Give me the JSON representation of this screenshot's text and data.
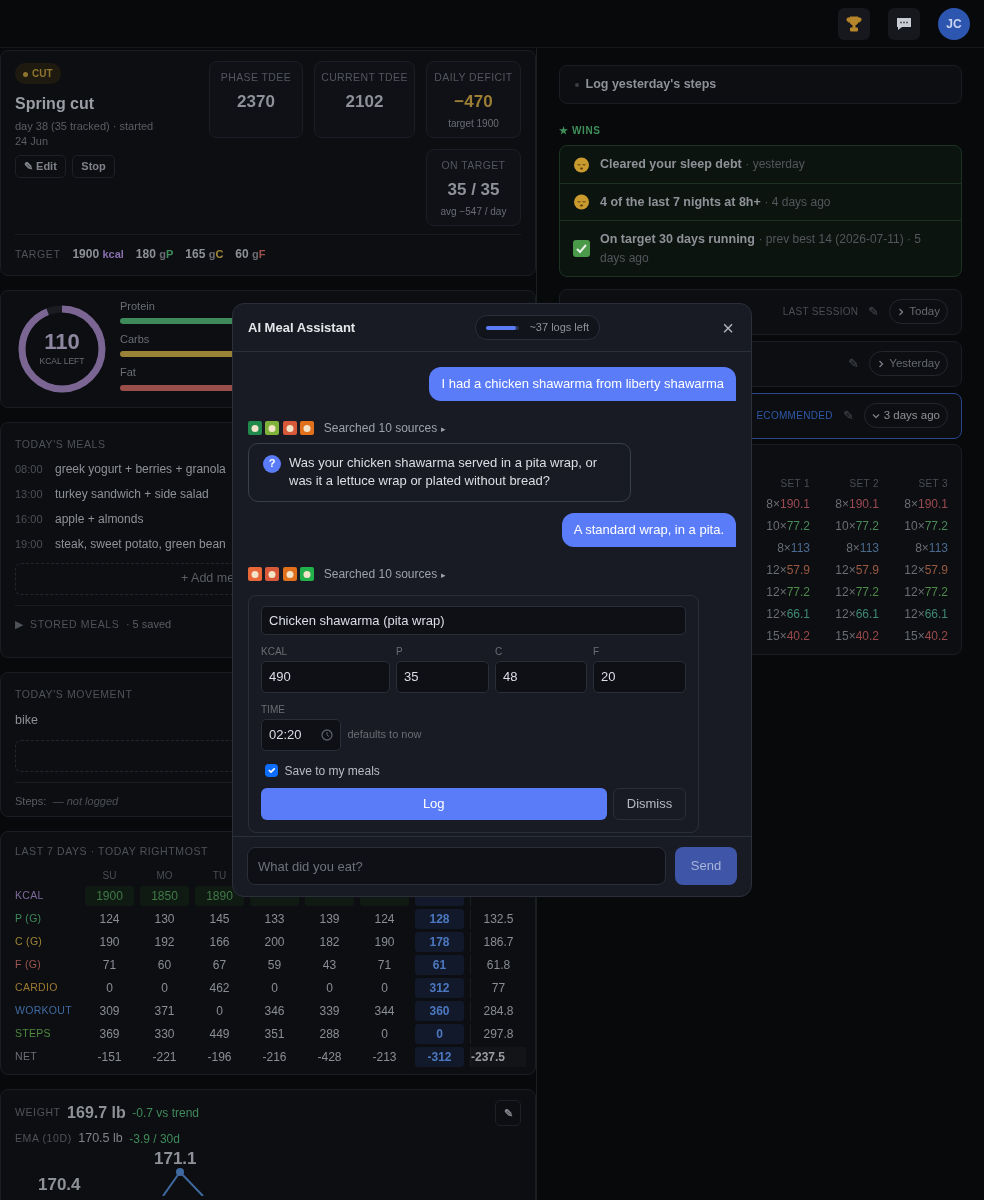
{
  "top_bar": {
    "avatar": "JC"
  },
  "phase": {
    "badge": "CUT",
    "title": "Spring cut",
    "subtitle": "day 38 (35 tracked) · started 24 Jun",
    "buttons": [
      "✎ Edit",
      "Stop"
    ],
    "stats": [
      {
        "label": "PHASE TDEE",
        "value": "2370",
        "kind": "plain"
      },
      {
        "label": "CURRENT TDEE",
        "value": "2102",
        "kind": "plain"
      },
      {
        "label": "DAILY DEFICIT",
        "value": "−470",
        "note": "target 1900",
        "kind": "accent"
      },
      {
        "label": "ON TARGET",
        "value": "35 / 35",
        "note": "avg −547 / day",
        "kind": "plain"
      }
    ],
    "target_label": "TARGET",
    "targets": [
      {
        "value": "1900",
        "macro": "kcal",
        "color": "#8a6fae"
      },
      {
        "value": "180",
        "unit": "g",
        "macro": "P",
        "color": "#3f8f5a"
      },
      {
        "value": "165",
        "unit": "g",
        "macro": "C",
        "color": "#a38a35"
      },
      {
        "value": "60",
        "unit": "g",
        "macro": "F",
        "color": "#a0504a"
      }
    ]
  },
  "macros": {
    "ring": {
      "value": "110",
      "label": "KCAL LEFT",
      "level": 0.94
    },
    "bars": [
      {
        "label": "Protein",
        "color": "#3f8a5a"
      },
      {
        "label": "Carbs",
        "color": "#9a8236"
      },
      {
        "label": "Fat",
        "color": "#9a4e4a"
      }
    ]
  },
  "meals": {
    "title": "TODAY'S MEALS",
    "items": [
      {
        "time": "08:00",
        "name": "greek yogurt + berries + granola"
      },
      {
        "time": "13:00",
        "name": "turkey sandwich + side salad"
      },
      {
        "time": "16:00",
        "name": "apple + almonds"
      },
      {
        "time": "19:00",
        "name": "steak, sweet potato, green bean"
      }
    ],
    "add_button": "+ Add me",
    "stored_arrow": "▶",
    "stored_label": "STORED MEALS",
    "stored_count": "· 5 saved"
  },
  "movement": {
    "title": "TODAY'S MOVEMENT",
    "activity": "bike",
    "steps_label": "Steps:",
    "steps_value": "— not logged"
  },
  "last7": {
    "title": "LAST 7 DAYS · TODAY RIGHTMOST",
    "days": [
      "SU",
      "MO",
      "TU"
    ],
    "rows": [
      {
        "label": "KCAL",
        "kind": "kcal",
        "color": "#7e6a9b",
        "values": [
          "1900",
          "1850",
          "1890"
        ]
      },
      {
        "label": "P (G)",
        "kind": "plain",
        "color": "#3f8a5a",
        "values": [
          "124",
          "130",
          "145",
          "133",
          "139",
          "124"
        ],
        "today": "128",
        "average": "132.5"
      },
      {
        "label": "C (G)",
        "kind": "plain",
        "color": "#a08636",
        "values": [
          "190",
          "192",
          "166",
          "200",
          "182",
          "190"
        ],
        "today": "178",
        "average": "186.7"
      },
      {
        "label": "F (G)",
        "kind": "plain",
        "color": "#a0564f",
        "values": [
          "71",
          "60",
          "67",
          "59",
          "43",
          "71"
        ],
        "today": "61",
        "average": "61.8"
      },
      {
        "label": "CARDIO",
        "kind": "plain",
        "color": "#9c7a32",
        "values": [
          "0",
          "0",
          "462",
          "0",
          "0",
          "0"
        ],
        "today": "312",
        "average": "77"
      },
      {
        "label": "WORKOUT",
        "kind": "plain",
        "color": "#3f6aa0",
        "values": [
          "309",
          "371",
          "0",
          "346",
          "339",
          "344"
        ],
        "today": "360",
        "average": "284.8"
      },
      {
        "label": "STEPS",
        "kind": "plain",
        "color": "#4f8a3f",
        "values": [
          "369",
          "330",
          "449",
          "351",
          "288",
          "0"
        ],
        "today": "0",
        "average": "297.8"
      },
      {
        "label": "NET",
        "kind": "net",
        "color": "#6d7077",
        "values": [
          "-151",
          "-221",
          "-196",
          "-216",
          "-428",
          "-213"
        ],
        "today": "-312",
        "average": "-237.5"
      }
    ]
  },
  "weight": {
    "label": "WEIGHT",
    "value": "169.7 lb",
    "delta": "-0.7 vs trend",
    "edit": "✎",
    "ema_label": "EMA (10D)",
    "ema_value": "170.5 lb",
    "ema_delta": "-3.9 / 30d",
    "point_labels": [
      "171.1",
      "170.4"
    ]
  },
  "tasks": [
    {
      "text": "Log yesterday's steps"
    }
  ],
  "wins_star": "★",
  "wins_title": "WINS",
  "wins": [
    {
      "kind": "sleep",
      "title": "Cleared your sleep debt",
      "meta": "· yesterday"
    },
    {
      "kind": "sleep",
      "title": "4 of the last 7 nights at 8h+",
      "meta": "· 4 days ago"
    },
    {
      "kind": "check",
      "title": "On target 30 days running",
      "meta": "· prev best 14 (2026-07-11) · 5 days ago"
    }
  ],
  "sessions": [
    {
      "label": "LAST SESSION",
      "edit": "✎",
      "pill": "Today",
      "expanded": false,
      "selected": false
    },
    {
      "edit": "✎",
      "pill": "Yesterday",
      "expanded": false,
      "selected": false
    },
    {
      "label": "ECOMMENDED",
      "edit": "✎",
      "pill": "3 days ago",
      "expanded": true,
      "selected": true
    }
  ],
  "sets": {
    "headers": [
      "SET 1",
      "SET 2",
      "SET 3"
    ],
    "rows": [
      {
        "color": "#9a4a52",
        "sets": [
          {
            "reps": "8×",
            "weight": "190.1"
          },
          {
            "reps": "8×",
            "weight": "190.1"
          },
          {
            "reps": "8×",
            "weight": "190.1"
          }
        ]
      },
      {
        "color": "#4a8a58",
        "sets": [
          {
            "reps": "10×",
            "weight": "77.2"
          },
          {
            "reps": "10×",
            "weight": "77.2"
          },
          {
            "reps": "10×",
            "weight": "77.2"
          }
        ]
      },
      {
        "color": "#4a6a8e",
        "sets": [
          {
            "reps": "8×",
            "weight": "113"
          },
          {
            "reps": "8×",
            "weight": "113"
          },
          {
            "reps": "8×",
            "weight": "113"
          }
        ]
      },
      {
        "color": "#9a5a42",
        "sets": [
          {
            "reps": "12×",
            "weight": "57.9"
          },
          {
            "reps": "12×",
            "weight": "57.9"
          },
          {
            "reps": "12×",
            "weight": "57.9"
          }
        ]
      },
      {
        "color": "#4f8a4a",
        "sets": [
          {
            "reps": "12×",
            "weight": "77.2"
          },
          {
            "reps": "12×",
            "weight": "77.2"
          },
          {
            "reps": "12×",
            "weight": "77.2"
          }
        ]
      },
      {
        "color": "#3f8a72",
        "sets": [
          {
            "reps": "12×",
            "weight": "66.1"
          },
          {
            "reps": "12×",
            "weight": "66.1"
          },
          {
            "reps": "12×",
            "weight": "66.1"
          }
        ]
      },
      {
        "color": "#9a4a4a",
        "sets": [
          {
            "reps": "15×",
            "weight": "40.2"
          },
          {
            "reps": "15×",
            "weight": "40.2"
          },
          {
            "reps": "15×",
            "weight": "40.2"
          }
        ]
      }
    ]
  },
  "assistant": {
    "title": "AI Meal Assistant",
    "quota": {
      "level": 0.9,
      "text": "~37 logs left"
    },
    "close": "×",
    "messages": [
      {
        "kind": "user",
        "text": "I had a chicken shawarma from liberty shawarma"
      },
      {
        "kind": "sources",
        "text": "Searched 10 sources",
        "arrow": "▸",
        "sites": [
          {
            "color": "#1f8a4c"
          },
          {
            "color": "#7fb23a"
          },
          {
            "color": "#d8583a"
          },
          {
            "color": "#e0701c"
          }
        ]
      },
      {
        "kind": "question",
        "mark": "?",
        "text": "Was your chicken shawarma served in a pita wrap, or was it a lettuce wrap or plated without bread?"
      },
      {
        "kind": "user",
        "text": "A standard wrap, in a pita."
      },
      {
        "kind": "sources",
        "text": "Searched 10 sources",
        "arrow": "▸",
        "sites": [
          {
            "color": "#e8683a"
          },
          {
            "color": "#d8583a"
          },
          {
            "color": "#e0701c"
          },
          {
            "color": "#22b04a"
          }
        ]
      },
      {
        "kind": "meal_form",
        "name": "Chicken shawarma (pita wrap)",
        "fields": [
          {
            "label": "KCAL",
            "value": "490"
          },
          {
            "label": "P",
            "value": "35"
          },
          {
            "label": "C",
            "value": "48"
          },
          {
            "label": "F",
            "value": "20"
          }
        ],
        "time_label": "TIME",
        "time": "02:20",
        "time_hint": "defaults to now",
        "save": {
          "label": "Save to my meals",
          "checked": true
        },
        "log_button": "Log",
        "dismiss_button": "Dismiss"
      }
    ],
    "input": {
      "placeholder": "What did you eat?"
    },
    "send": {
      "label": "Send",
      "disabled": true
    }
  }
}
